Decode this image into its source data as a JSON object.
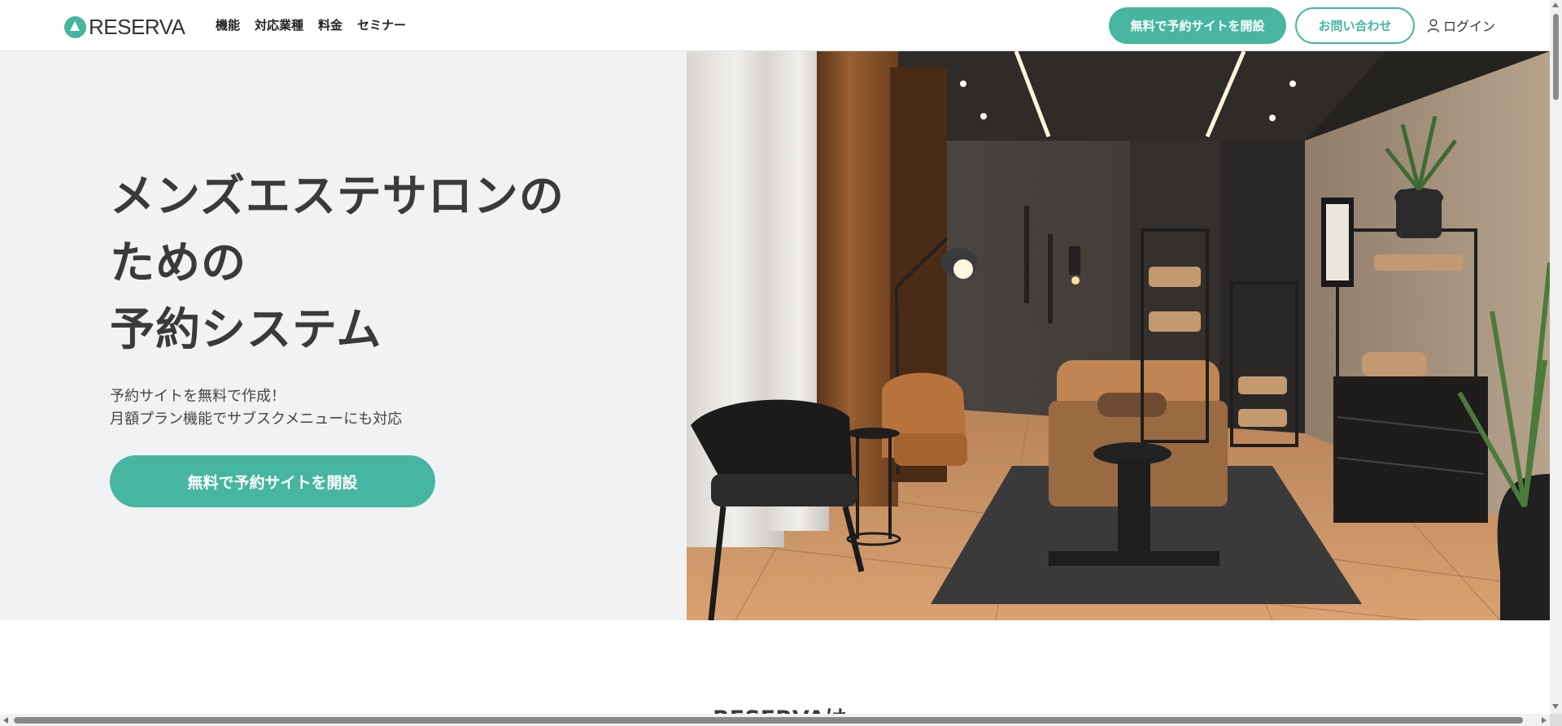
{
  "header": {
    "logo_text": "RESERVA",
    "nav": [
      "機能",
      "対応業種",
      "料金",
      "セミナー"
    ],
    "cta_label": "無料で予約サイトを開設",
    "contact_label": "お問い合わせ",
    "login_label": "ログイン"
  },
  "hero": {
    "title_lines": [
      "メンズエステサロンの",
      "ための",
      "予約システム"
    ],
    "subtitle_lines": [
      "予約サイトを無料で作成！",
      "月額プラン機能でサブスクメニューにも対応"
    ],
    "cta_label": "無料で予約サイトを開設",
    "image_subject": "men's esthetic salon treatment room"
  },
  "next_section": {
    "heading_peek": "RESERVAは"
  },
  "colors": {
    "accent": "#46b6a0",
    "hero_bg": "#f1f2f4",
    "text": "#3a3a3a"
  }
}
